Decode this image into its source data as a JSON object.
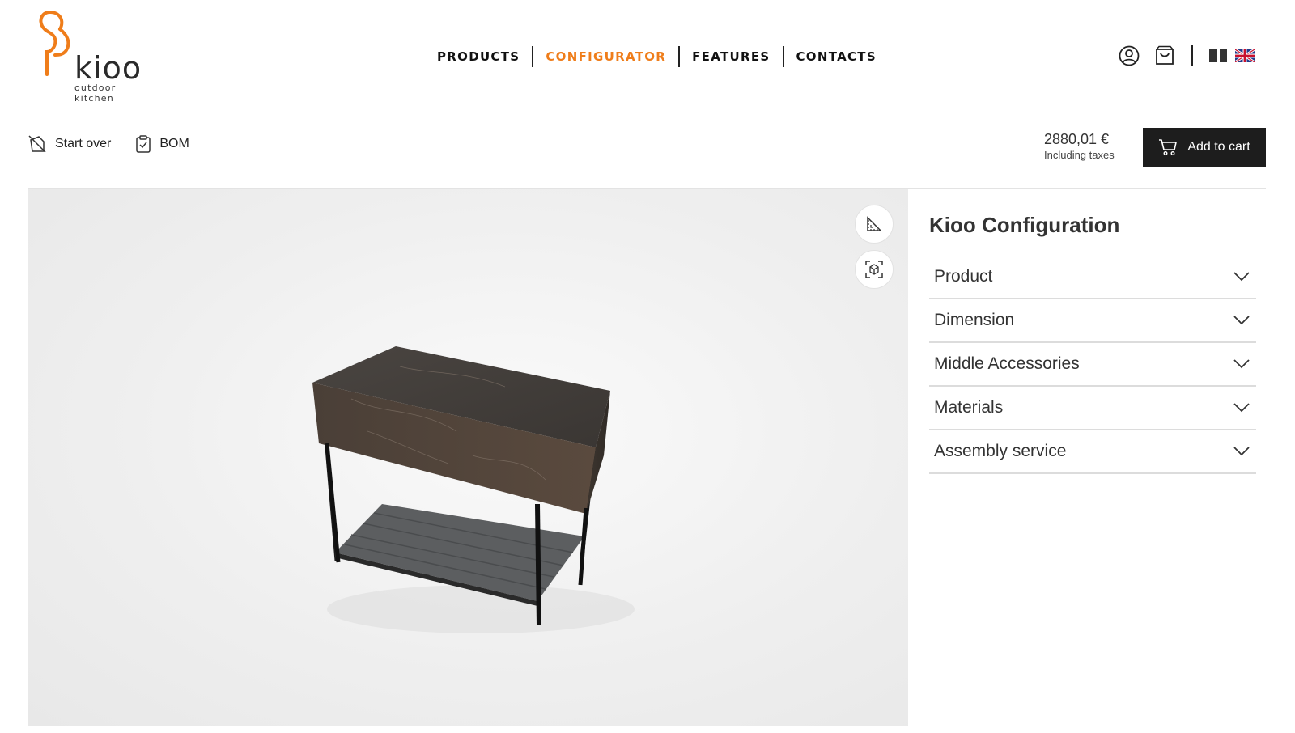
{
  "brand": {
    "name": "kioo",
    "tagline": "outdoor kitchen",
    "accent": "#ef7d1a"
  },
  "nav": {
    "items": [
      {
        "label": "PRODUCTS",
        "active": false
      },
      {
        "label": "CONFIGURATOR",
        "active": true
      },
      {
        "label": "FEATURES",
        "active": false
      },
      {
        "label": "CONTACTS",
        "active": false
      }
    ]
  },
  "header_icons": [
    "user-icon",
    "shopping-bag-icon",
    "flag-it-icon",
    "flag-uk-icon"
  ],
  "toolbar": {
    "start_over": {
      "label": "Start over",
      "icon": "start-over-icon"
    },
    "bom": {
      "label": "BOM",
      "icon": "clipboard-check-icon"
    },
    "price": "2880,01 €",
    "price_note": "Including taxes",
    "add_to_cart": {
      "label": "Add to cart",
      "icon": "cart-icon"
    }
  },
  "viewer": {
    "tools": [
      "measure-icon",
      "3d-view-icon"
    ]
  },
  "config": {
    "title": "Kioo Configuration",
    "sections": [
      {
        "label": "Product"
      },
      {
        "label": "Dimension"
      },
      {
        "label": "Middle Accessories"
      },
      {
        "label": "Materials"
      },
      {
        "label": "Assembly service"
      }
    ]
  }
}
